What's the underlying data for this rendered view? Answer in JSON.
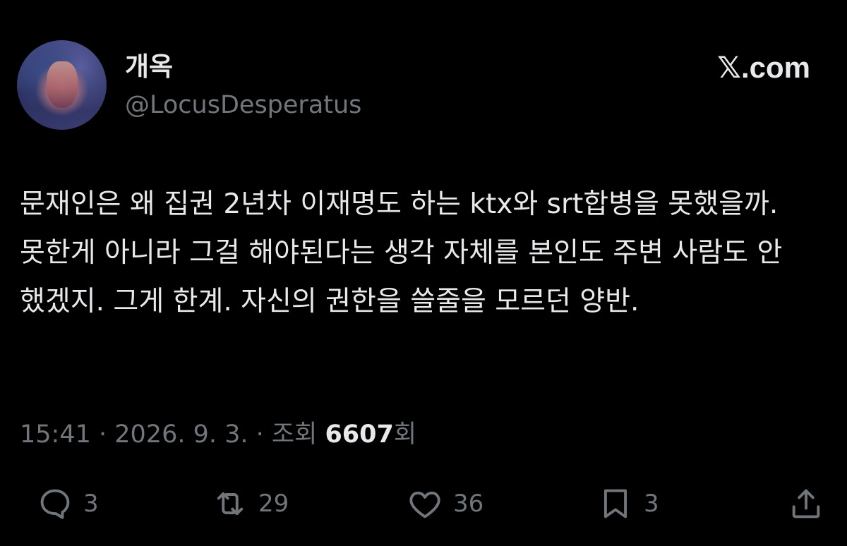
{
  "author": {
    "display_name": "개옥",
    "handle": "@LocusDesperatus"
  },
  "brand": "𝕏.com",
  "tweet": {
    "text": "문재인은 왜 집권 2년차 이재명도 하는 ktx와 srt합병을 못했을까. 못한게 아니라 그걸 해야된다는 생각 자체를 본인도 주변 사람도 안 했겠지. 그게 한계. 자신의 권한을 쓸줄을 모르던 양반."
  },
  "meta": {
    "time": "15:41",
    "separator": " · ",
    "date": "2026. 9. 3.",
    "views_label": "조회 ",
    "views_count": "6607",
    "views_suffix": "회"
  },
  "actions": {
    "replies": "3",
    "reposts": "29",
    "likes": "36",
    "bookmarks": "3"
  },
  "colors": {
    "background": "#000000",
    "primary_text": "#e7e9ea",
    "secondary_text": "#71767b"
  },
  "icons": [
    "reply-icon",
    "repost-icon",
    "like-icon",
    "bookmark-icon",
    "share-icon"
  ]
}
